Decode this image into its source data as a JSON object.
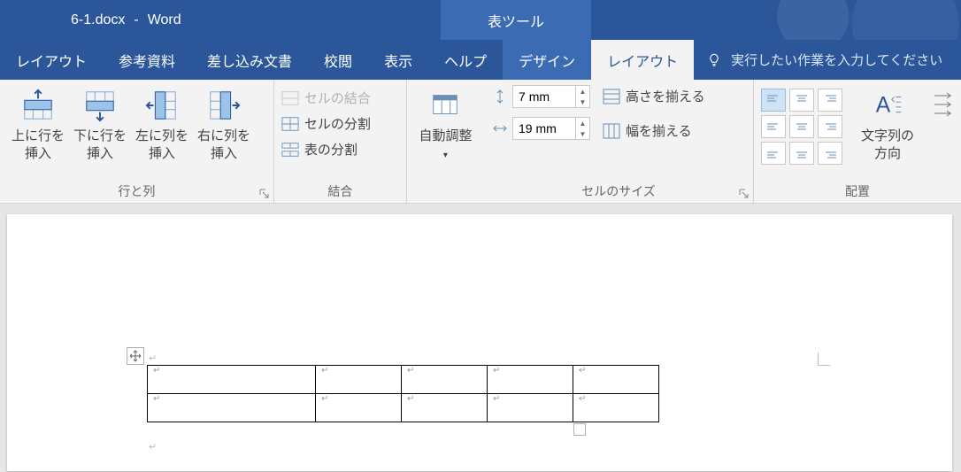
{
  "title": {
    "filename": "6-1.docx",
    "sep": "-",
    "app": "Word",
    "context": "表ツール"
  },
  "tabs": {
    "layout1": "レイアウト",
    "references": "参考資料",
    "mailings": "差し込み文書",
    "review": "校閲",
    "view": "表示",
    "help": "ヘルプ",
    "design": "デザイン",
    "table_layout": "レイアウト",
    "tellme": "実行したい作業を入力してください"
  },
  "ribbon": {
    "rows_cols": {
      "insert_above": "上に行を\n挿入",
      "insert_below": "下に行を\n挿入",
      "insert_left": "左に列を\n挿入",
      "insert_right": "右に列を\n挿入",
      "group": "行と列"
    },
    "merge": {
      "merge": "セルの結合",
      "split": "セルの分割",
      "split_table": "表の分割",
      "group": "結合"
    },
    "autofit": {
      "label": "自動調整"
    },
    "size": {
      "height": "7 mm",
      "width": "19 mm",
      "dist_rows": "高さを揃える",
      "dist_cols": "幅を揃える",
      "group": "セルのサイズ"
    },
    "align": {
      "textdir": "文字列の\n方向",
      "group": "配置"
    }
  },
  "doc": {
    "cell_mark": "↵",
    "para_mark": "↵"
  }
}
